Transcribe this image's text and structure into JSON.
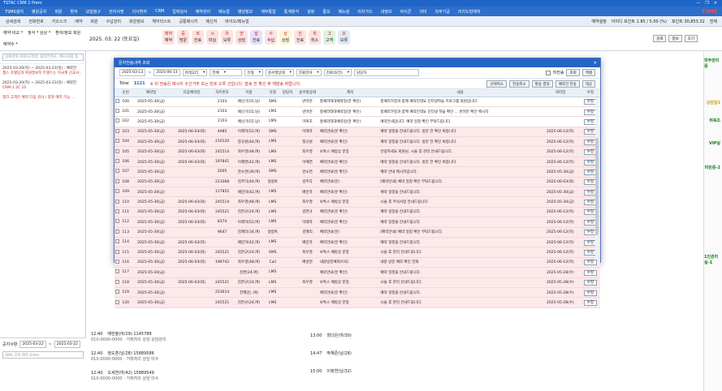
{
  "app": {
    "title": "TSTAC CRM 2 Prem",
    "window_controls": [
      "—",
      "❐",
      "✕"
    ]
  },
  "menu": [
    "TSMS설치",
    "병원공지",
    "회원",
    "환자",
    "보험청구",
    "전자서명",
    "의사환자",
    "CRM",
    "입력검사",
    "예약관리",
    "메뉴얼",
    "병원정보",
    "재무통합",
    "통계분석",
    "설정",
    "통보",
    "메뉴설",
    "리치가드",
    "내정보",
    "아이콘",
    "의미",
    "외부기공",
    "리치드판매처"
  ],
  "brand": "TSMS",
  "toolbar": {
    "items": [
      "상세검색",
      "전화번호",
      "키오스크",
      "예약",
      "회원",
      "수납관리",
      "회원정보",
      "헤어리스트",
      "공통메시지",
      "메신저",
      "바이오/메뉴얼"
    ],
    "right": [
      "예약설정",
      "아이디 포인트 1.85 / 5.00 (%)",
      "포인트 30,853.32",
      "전체"
    ]
  },
  "subtool": {
    "tabs": [
      "예약 비교 *",
      "정식 * 상상 *",
      "환자/정보 회원",
      "예약수 *"
    ],
    "date": "2025. 03. 22 (토요일)",
    "chips": [
      {
        "label": "예약",
        "sub": "예약",
        "bg": "#fde2e2"
      },
      {
        "label": "중",
        "sub": "방문",
        "bg": "#fde2e2"
      },
      {
        "label": "회",
        "sub": "진료",
        "bg": "#fde2e2"
      },
      {
        "label": "시",
        "sub": "미실",
        "bg": "#fde2e2"
      },
      {
        "label": "차",
        "sub": "보류",
        "bg": "#fde2e2"
      },
      {
        "label": "면",
        "sub": "상담",
        "bg": "#fde2e2"
      },
      {
        "label": "잡",
        "sub": "진료",
        "bg": "#e6e0fb"
      },
      {
        "label": "수",
        "sub": "수납",
        "bg": "#fde2e2"
      },
      {
        "label": "상",
        "sub": "상담",
        "bg": "#fdf5d4"
      },
      {
        "label": "진",
        "sub": "진료",
        "bg": "#fde2e2"
      },
      {
        "label": "취",
        "sub": "취소",
        "bg": "#fde2e2"
      },
      {
        "label": "고",
        "sub": "고객",
        "bg": "#dff3df"
      },
      {
        "label": "보",
        "sub": "보류",
        "bg": "#dfeaf8"
      }
    ],
    "right_buttons": [
      "검색",
      "정보",
      "초기"
    ]
  },
  "left_panel": {
    "search_placeholder": "상세검색 회원/고객명, 휴대폰번호, 메모/내용 등",
    "notes": [
      {
        "head": "2025-03-20(목) ~ 2025-03-23(일) : 예약전",
        "body": "챔스 호텔당과 학원정보지 트렌드는 미국계 선교사..."
      },
      {
        "head": "2025-03-20(목) ~ 2025-03-23(일) : 예약전",
        "body": "CRM-1 2C 10"
      },
      {
        "head": "",
        "body": "정리 고객은 예약 다음 검사 / 결과 예측 가능 ..."
      }
    ]
  },
  "bottom_panel": {
    "memo_label": "공지사항",
    "date_from": "2025-03-22",
    "date_to": "2025-03-22",
    "placeholder": "SMS 고객 제목 Enter"
  },
  "right_rail": [
    {
      "label": "피부관리중",
      "color": "#1a7a1a"
    },
    {
      "label": "상담일3",
      "color": "#d4a000"
    },
    {
      "label": "피복조",
      "color": "#1a7a1a"
    },
    {
      "label": "VIP실",
      "color": "#1a7a1a"
    },
    {
      "label": "피린중-2",
      "color": "#1a7a1a"
    },
    {
      "label": "1인관리실-1",
      "color": "#1a7a1a"
    }
  ],
  "modal": {
    "title": "문자전송내역 조회",
    "close": "✕",
    "filters": {
      "date_from": "2025-03-13",
      "date_to": "2025-06-13",
      "type": "카테고리",
      "status": "전체",
      "target": "유형",
      "send_status": "송수발상태",
      "department": "진료분야",
      "doctor": "진료의(전)",
      "manager": "담당자",
      "check_label": "미전송",
      "search_button": "조회",
      "excel_button": "엑셀"
    },
    "total_label": "Total",
    "total_value": "1121",
    "total_note": "※ 미 전송은 메시지 수신거부 또는 번호 오류 건입니다. 발송 전 확인 후 재발송 바랍니다.",
    "toolbar_right": [
      "선택취소",
      "전송취소",
      "발송 결과",
      "예약건 전송",
      "대상"
    ],
    "columns": [
      "",
      "순번",
      "예약일",
      "다음예약일",
      "차트번호",
      "이름",
      "유형",
      "담당자",
      "송수발상태",
      "제목",
      "내용",
      "처리일",
      "수정"
    ],
    "rows": [
      {
        "n": "100",
        "d1": "2025-05-30(금)",
        "d2": "",
        "chart": "2103",
        "name": "배선기(55,남)",
        "type": "SMS",
        "mgr": "",
        "status": "반려만",
        "title": "흥패러대대예약일(분 확인)",
        "content": "흥패러가정과 함께 예약인데요 인터넷학습 프로그램 회원입니다.",
        "date": "",
        "cls": "white"
      },
      {
        "n": "101",
        "d1": "2025-05-30(금)",
        "d2": "",
        "chart": "2103",
        "name": "배선기(55,남)",
        "type": "LMS",
        "mgr": "",
        "status": "반려만",
        "title": "흥패러대대예약일(분 확인)",
        "content": "흥패러가정과 함께 예약인데요 인터넷 학습 확인 ... 반려만 확인 메시지",
        "date": "",
        "cls": "white"
      },
      {
        "n": "102",
        "d1": "2025-05-30(금)",
        "d2": "",
        "chart": "2103",
        "name": "배선기(55,남)",
        "type": "LMS",
        "mgr": "",
        "status": "미복조",
        "title": "흥패러대대예약일(분 확인)",
        "content": "예약안내입니다. 예약 일정 확인 부탁드립니다.",
        "date": "",
        "cls": "white"
      },
      {
        "n": "103",
        "d1": "2025-05-30(금)",
        "d2": "2025-06-03(화)",
        "chart": "4985",
        "name": "이레하(52,여)",
        "type": "SMS",
        "mgr": "",
        "status": "이레하",
        "title": "예약안내(분 확인)",
        "content": "예약 일정을 안내드립니다. 방문 전 확인 바랍니다.",
        "date": "2025-06-12(목)",
        "cls": "pink"
      },
      {
        "n": "104",
        "d1": "2025-05-30(금)",
        "d2": "2025-06-03(화)",
        "chart": "210120",
        "name": "정규원(44,여)",
        "type": "LMS",
        "mgr": "",
        "status": "정규원",
        "title": "예약안내(분 확인)",
        "content": "예약 일정을 안내드립니다. 방문 전 확인 바랍니다.",
        "date": "2025-06-12(목)",
        "cls": "pink"
      },
      {
        "n": "105",
        "d1": "2025-05-30(금)",
        "d2": "2025-06-03(화)",
        "chart": "245514",
        "name": "최우영(48,여)",
        "type": "LMS",
        "mgr": "",
        "status": "최우영",
        "title": "보톡스 예방상 분장",
        "content": "안녕하세요 회원님. 시술 후 관리 안내드립니다.",
        "date": "2025-06-12(목)",
        "cls": "pink"
      },
      {
        "n": "106",
        "d1": "2025-05-30(금)",
        "d2": "2025-06-03(화)",
        "chart": "197841",
        "name": "이혜연(42,여)",
        "type": "LMS",
        "mgr": "",
        "status": "이혜연",
        "title": "예약안내(분 확인)",
        "content": "예약 일정을 안내드립니다. 방문 전 확인 바랍니다.",
        "date": "2025-06-12(목)",
        "cls": "pink"
      },
      {
        "n": "107",
        "d1": "2025-05-30(금)",
        "d2": "",
        "chart": "2005",
        "name": "한소연(39,여)",
        "type": "SMS",
        "mgr": "",
        "status": "한소연",
        "title": "예약안내(분 확인)",
        "content": "예약 안내 메시지입니다.",
        "date": "2025-05-30(금)",
        "cls": "pink"
      },
      {
        "n": "108",
        "d1": "2025-05-30(금)",
        "d2": "",
        "chart": "221068",
        "name": "김주다(44,여)",
        "type": "알림톡",
        "mgr": "",
        "status": "김주다",
        "title": "예약안내(분)",
        "content": "[예약안내] 예약 일정 확인 부탁드립니다.",
        "date": "2025-06-03(화)",
        "cls": "pink"
      },
      {
        "n": "109",
        "d1": "2025-05-30(금)",
        "d2": "",
        "chart": "117852",
        "name": "배민하(42,여)",
        "type": "LMS",
        "mgr": "",
        "status": "배민하",
        "title": "예약안내(분 확인)",
        "content": "예약 일정을 안내드립니다.",
        "date": "2025-05-30(금)",
        "cls": "pink"
      },
      {
        "n": "110",
        "d1": "2025-05-30(금)",
        "d2": "2025-06-03(화)",
        "chart": "245514",
        "name": "최우영(48,여)",
        "type": "LMS",
        "mgr": "",
        "status": "최우영",
        "title": "보톡스 예방상 분장",
        "content": "시술 후 주의사항 안내드립니다.",
        "date": "2025-05-30(금)",
        "cls": "pink"
      },
      {
        "n": "111",
        "d1": "2025-05-30(금)",
        "d2": "2025-06-03(화)",
        "chart": "245521",
        "name": "김연규(24,여)",
        "type": "LMS",
        "mgr": "",
        "status": "김연규",
        "title": "예약안내(분 확인)",
        "content": "예약 일정을 안내드립니다.",
        "date": "2025-06-12(목)",
        "cls": "pink"
      },
      {
        "n": "112",
        "d1": "2025-05-30(금)",
        "d2": "2025-06-03(화)",
        "chart": "8374",
        "name": "이레하(52,여)",
        "type": "LMS",
        "mgr": "",
        "status": "이레하",
        "title": "예약안내(분 확인)",
        "content": "예약 일정을 안내드립니다.",
        "date": "2025-06-12(목)",
        "cls": "pink"
      },
      {
        "n": "113",
        "d1": "2025-05-30(금)",
        "d2": "",
        "chart": "9647",
        "name": "김혜리(34,여)",
        "type": "알림톡",
        "mgr": "",
        "status": "김혜리",
        "title": "예약안내(분)",
        "content": "[예약안내] 예약 일정 확인 부탁드립니다.",
        "date": "2025-06-12(목)",
        "cls": "pink"
      },
      {
        "n": "114",
        "d1": "2025-05-30(금)",
        "d2": "2025-06-03(화)",
        "chart": "",
        "name": "배민하(42,여)",
        "type": "LMS",
        "mgr": "",
        "status": "배민하",
        "title": "예약안내(분 확인)",
        "content": "예약 일정을 안내드립니다.",
        "date": "2025-06-12(목)",
        "cls": "pink"
      },
      {
        "n": "115",
        "d1": "2025-05-30(금)",
        "d2": "2025-06-03(화)",
        "chart": "245521",
        "name": "김연규(24,여)",
        "type": "SMS",
        "mgr": "",
        "status": "최우영",
        "title": "보톡스 예방상 분장",
        "content": "시술 후 관리 안내드립니다.",
        "date": "2025-06-12(목)",
        "cls": "pink"
      },
      {
        "n": "116",
        "d1": "2025-05-30(금)",
        "d2": "2025-06-03(화)",
        "chart": "199742",
        "name": "최우영(48,여)",
        "type": "Call",
        "mgr": "",
        "status": "배성현",
        "title": "내원방문예약(F/S)",
        "content": "내원 방문 예약 확인 전화",
        "date": "2025-06-12(목)",
        "cls": "pink"
      },
      {
        "n": "117",
        "d1": "2025-05-30(금)",
        "d2": "",
        "chart": "",
        "name": "김연(24,여)",
        "type": "LMS",
        "mgr": "",
        "status": "",
        "title": "예약안내(분 확인)",
        "content": "예약 일정을 안내드립니다.",
        "date": "2025-05-28(수)",
        "cls": "pink"
      },
      {
        "n": "118",
        "d1": "2025-05-30(금)",
        "d2": "2025-06-03(화)",
        "chart": "245521",
        "name": "김연규(24,여)",
        "type": "LMS",
        "mgr": "",
        "status": "최우영",
        "title": "보톡스 예방상 분장",
        "content": "시술 후 관리 안내드립니다.",
        "date": "2025-05-28(수)",
        "cls": "pink"
      },
      {
        "n": "119",
        "d1": "2025-05-30(금)",
        "d2": "",
        "chart": "253614",
        "name": "전혜민(.,여)",
        "type": "LMS",
        "mgr": "",
        "status": "",
        "title": "예약안내(분 확인)",
        "content": "예약 일정을 안내드립니다.",
        "date": "2025-05-28(수)",
        "cls": "pink"
      },
      {
        "n": "120",
        "d1": "2025-05-30(금)",
        "d2": "",
        "chart": "245521",
        "name": "김연규(24,여)",
        "type": "LMS",
        "mgr": "",
        "status": "",
        "title": "보톡스 예방상 분장",
        "content": "시술 후 관리 안내드립니다.",
        "date": "2025-05-28(수)",
        "cls": "pink"
      }
    ],
    "edit_label": "수정"
  },
  "bg_list_left": [
    {
      "time": "12:40",
      "name": "배한솔(여/29) 1145788",
      "sub": "010-0000-0000 · 거래처의 상담 상담관리"
    },
    {
      "time": "12:40",
      "name": "정도훈(남/28) 15889586",
      "sub": "010-0000-0000 · 거래처의 상담 미수"
    },
    {
      "time": "12:40",
      "name": "오세연(여/42) 15889549",
      "sub": "010-0000-0000 · 거래처의 상담 미수"
    }
  ],
  "bg_list_right": [
    {
      "time": "13:00",
      "name": "최다은(여/30)"
    },
    {
      "time": "14:47",
      "name": "박혜준(남/28)"
    },
    {
      "time": "15:00",
      "name": "이정연(남/32)"
    }
  ]
}
